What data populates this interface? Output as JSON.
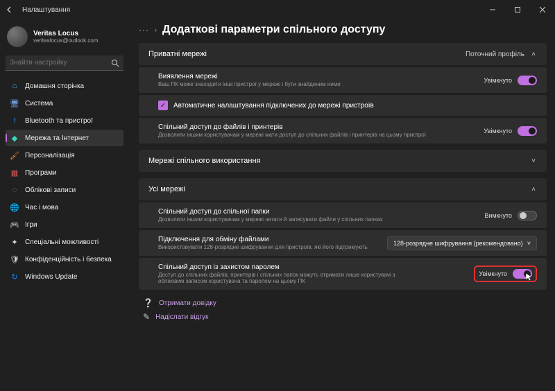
{
  "window": {
    "title": "Налаштування"
  },
  "profile": {
    "name": "Veritas Locus",
    "email": "veritaslocus@outlook.com"
  },
  "search": {
    "placeholder": "Знайти настройку"
  },
  "sidebar": {
    "items": [
      {
        "label": "Домашня сторінка"
      },
      {
        "label": "Система"
      },
      {
        "label": "Bluetooth та пристрої"
      },
      {
        "label": "Мережа та Інтернет"
      },
      {
        "label": "Персоналізація"
      },
      {
        "label": "Програми"
      },
      {
        "label": "Облікові записи"
      },
      {
        "label": "Час і мова"
      },
      {
        "label": "Ігри"
      },
      {
        "label": "Спеціальні можливості"
      },
      {
        "label": "Конфіденційність і безпека"
      },
      {
        "label": "Windows Update"
      }
    ]
  },
  "breadcrumb": {
    "ellipsis": "···",
    "caret": "›",
    "title": "Додаткові параметри спільного доступу"
  },
  "sections": {
    "private": {
      "header": "Приватні мережі",
      "profile_label": "Поточний профіль",
      "discovery": {
        "title": "Виявлення мережі",
        "desc": "Ваш ПК може знаходити інші пристрої у мережі і бути знайденим ними",
        "status": "Увімкнуто"
      },
      "auto_config": {
        "label": "Автоматичне налаштування підключених до мережі пристроїв"
      },
      "file_printer": {
        "title": "Спільний доступ до файлів і принтерів",
        "desc": "Дозволити іншим користувачам у мережі мати доступ до спільних файлів і принтерів на цьому пристрої",
        "status": "Увімкнуто"
      }
    },
    "shared_networks": {
      "header": "Мережі спільного використання"
    },
    "all_networks": {
      "header": "Усі мережі",
      "public_folder": {
        "title": "Спільний доступ до спільної папки",
        "desc": "Дозволити іншим користувачам у мережі читати й записувати файли у спільних папках",
        "status": "Вимкнуто"
      },
      "file_exchange": {
        "title": "Підключення для обміну файлами",
        "desc": "Використовувати 128-розрядне шифрування для пристроїв, які його підтримують",
        "dropdown": "128-розрядне шифрування (рекомендовано)"
      },
      "password_protected": {
        "title": "Спільний доступ із захистом паролем",
        "desc": "Доступ до спільних файлів, принтерів і спільних папок можуть отримати лише користувачі з обліковим записом користувача та паролем на цьому ПК",
        "status": "Увімкнуто"
      }
    }
  },
  "footer": {
    "help": "Отримати довідку",
    "feedback": "Надіслати відгук"
  }
}
